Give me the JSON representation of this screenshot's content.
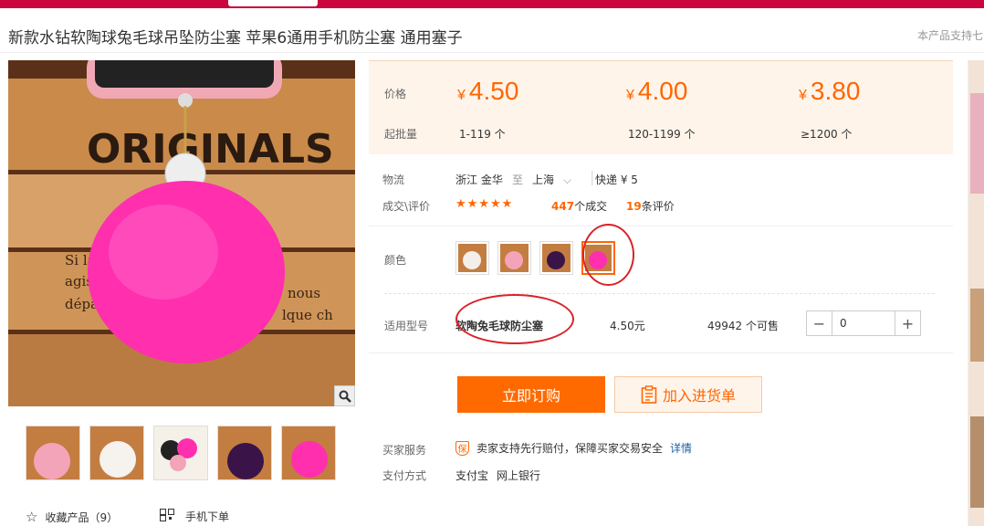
{
  "title": "新款水钻软陶球兔毛球吊坠防尘塞 苹果6通用手机防尘塞 通用塞子",
  "support_note": "本产品支持七",
  "price_panel": {
    "price_label": "价格",
    "moq_label": "起批量",
    "tiers": [
      {
        "currency": "¥",
        "price": "4.50",
        "qty": "1-119 个"
      },
      {
        "currency": "¥",
        "price": "4.00",
        "qty": "120-1199 个"
      },
      {
        "currency": "¥",
        "price": "3.80",
        "qty": "≥1200 个"
      }
    ]
  },
  "logistics": {
    "label": "物流",
    "from": "浙江 金华",
    "to_word": "至",
    "to": "上海",
    "shipping": "快递 ¥ 5"
  },
  "reviews": {
    "label": "成交\\评价",
    "star_rating": 5,
    "stars": "★★★★★",
    "deals_count": "447",
    "deals_suffix": "个成交",
    "review_count": "19",
    "review_suffix": "条评价"
  },
  "color": {
    "label": "颜色",
    "swatches": [
      "white-pompom",
      "pink-pompom",
      "purple-pompom",
      "magenta-pompom"
    ],
    "selected_index": 3
  },
  "model": {
    "label": "适用型号",
    "name": "软陶兔毛球防尘塞",
    "price": "4.50元",
    "stock": "49942 个可售",
    "quantity": "0",
    "minus": "−",
    "plus": "+"
  },
  "actions": {
    "order_label": "立即订购",
    "cart_label": "加入进货单"
  },
  "service": {
    "label": "买家服务",
    "text": "卖家支持先行赔付，保障买家交易安全",
    "link": "详情",
    "badge": "保"
  },
  "payment": {
    "label": "支付方式",
    "methods": [
      "支付宝",
      "网上银行"
    ]
  },
  "bottom": {
    "favorite_label": "收藏产品（9）",
    "mobile_label": "手机下单"
  },
  "image_text": {
    "crate": "ORIGINALS",
    "crate_small1": "Si la",
    "crate_small2": "agis",
    "crate_small3": "dépa",
    "crate_small4": "nous",
    "crate_small5": "lque ch"
  },
  "colors": {
    "brand_red": "#c9063d",
    "accent_orange": "#ff6a00",
    "annotation_red": "#d8232a"
  }
}
